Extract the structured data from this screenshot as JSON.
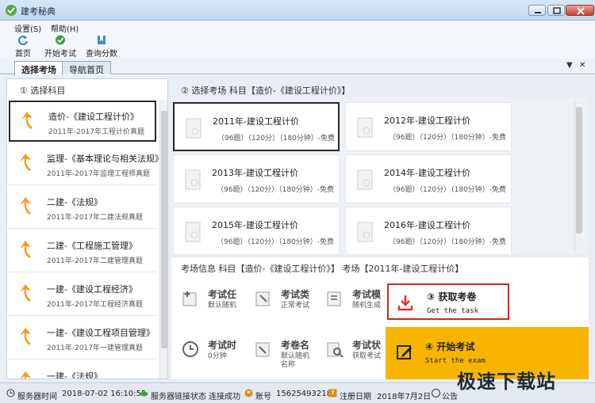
{
  "window": {
    "title": "建考秘典"
  },
  "menu": {
    "items": [
      "设置(S)",
      "帮助(H)"
    ]
  },
  "toolbar": {
    "home": "首页",
    "start_exam": "开始考试",
    "query_score": "查询分数"
  },
  "tabs": {
    "select_room": "选择考场",
    "nav_home": "导航首页"
  },
  "left": {
    "header": "① 选择科目",
    "subjects": [
      {
        "name": "造价-《建设工程计价》",
        "desc": "2011年-2017年工程计价真题"
      },
      {
        "name": "监理-《基本理论与相关法规》",
        "desc": "2011年-2017年监理工程师真题"
      },
      {
        "name": "二建-《法规》",
        "desc": "2011年-2017年二建法规真题"
      },
      {
        "name": "二建-《工程施工管理》",
        "desc": "2011年-2017年二建管理真题"
      },
      {
        "name": "一建-《建设工程经济》",
        "desc": "2011年-2017年工程经济真题"
      },
      {
        "name": "一建-《建设工程项目管理》",
        "desc": "2011年-2017年一建管理真题"
      },
      {
        "name": "一建-《法规》",
        "desc": ""
      }
    ]
  },
  "right": {
    "header": "② 选择考场  科目【造价-《建设工程计价》】",
    "exams": [
      {
        "name": "2011年-建设工程计价",
        "desc": "（96题）（120分）（180分钟）-免费"
      },
      {
        "name": "2012年-建设工程计价",
        "desc": "（96题）（120分）（180分钟）-免费"
      },
      {
        "name": "2013年-建设工程计价",
        "desc": "（96题）（120分）（180分钟）-免费"
      },
      {
        "name": "2014年-建设工程计价",
        "desc": "（96题）（120分）（180分钟）-免费"
      },
      {
        "name": "2015年-建设工程计价",
        "desc": "（96题）（120分）（180分钟）-免费"
      },
      {
        "name": "2016年-建设工程计价",
        "desc": "（96题）（120分）（180分钟）-免费"
      }
    ],
    "info_header": "考场信息  科目【造价-《建设工程计价》】 考场【2011年-建设工程计价】",
    "fields": [
      {
        "label": "考试任",
        "value": "默认随机"
      },
      {
        "label": "考试类",
        "value": "正常考试"
      },
      {
        "label": "考试模",
        "value": "随机生成"
      },
      {
        "label": "考试时",
        "value": "0分钟"
      },
      {
        "label": "考卷名",
        "value": "默认随机\n名称"
      },
      {
        "label": "考试状",
        "value": "获取考试"
      }
    ],
    "get_paper": {
      "title": "③ 获取考卷",
      "sub": "Get the task"
    },
    "start": {
      "title": "④ 开始考试",
      "sub": "Start the exam"
    }
  },
  "status": {
    "server_time_label": "服务器时间",
    "server_time": "2018-07-02 16:10:55",
    "link_label": "服务器链接状态",
    "link_value": "连接成功",
    "account_label": "账号",
    "account": "15625493218",
    "reg_label": "注册日期",
    "reg_date": "2018年7月2日",
    "notice": "公告"
  },
  "watermark": "极速下载站",
  "colors": {
    "accent": "#f7b500",
    "highlight": "#c82a22",
    "arrow": "#f0a020"
  }
}
